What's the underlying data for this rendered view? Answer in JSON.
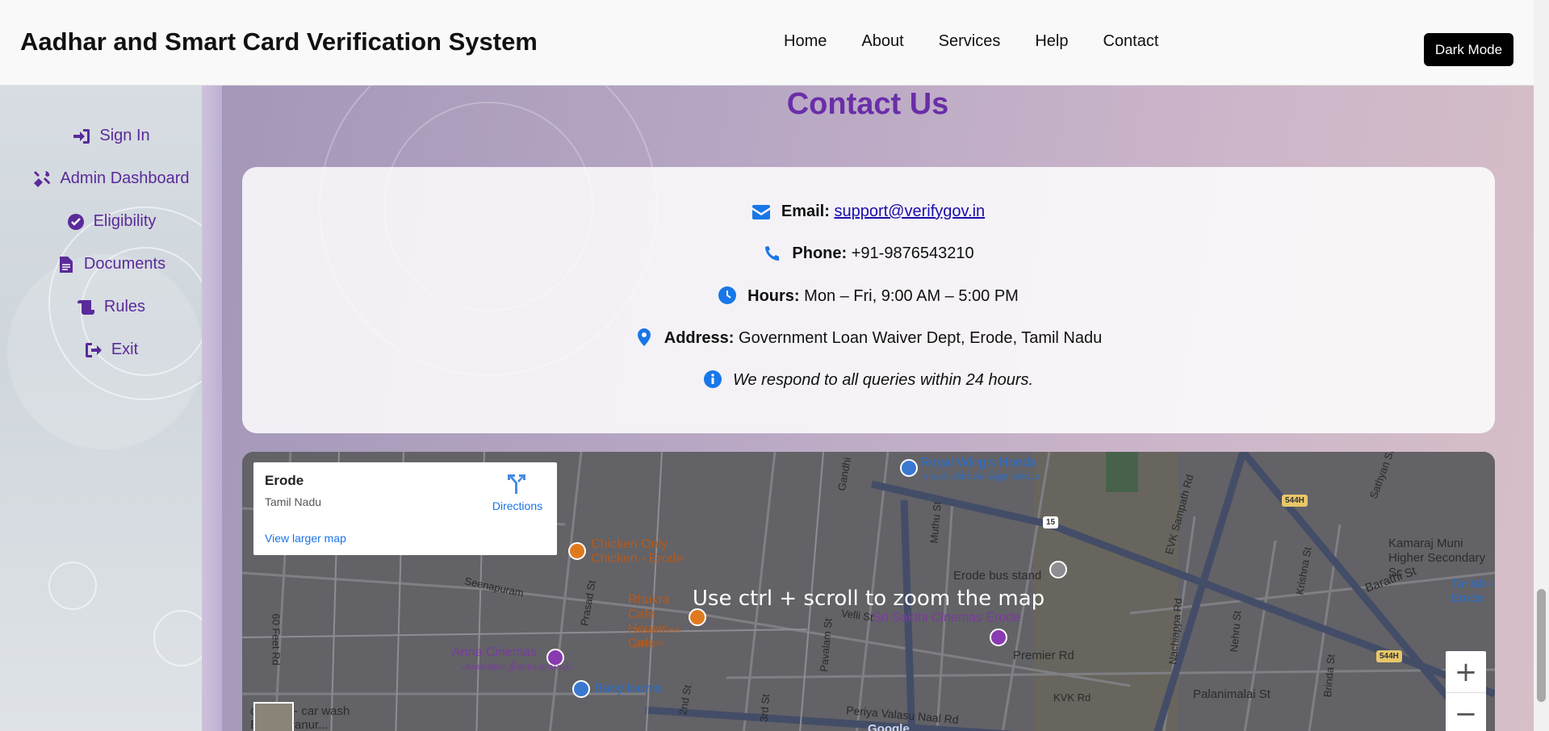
{
  "header": {
    "title": "Aadhar and Smart Card Verification System",
    "nav": [
      "Home",
      "About",
      "Services",
      "Help",
      "Contact"
    ],
    "dark_mode_label": "Dark Mode"
  },
  "sidebar": {
    "items": [
      {
        "label": "Sign In",
        "icon": "sign-in-icon"
      },
      {
        "label": "Admin Dashboard",
        "icon": "tools-icon"
      },
      {
        "label": "Eligibility",
        "icon": "check-circle-icon"
      },
      {
        "label": "Documents",
        "icon": "file-icon"
      },
      {
        "label": "Rules",
        "icon": "scroll-icon"
      },
      {
        "label": "Exit",
        "icon": "sign-out-icon"
      }
    ]
  },
  "contact": {
    "title": "Contact Us",
    "email_label": "Email:",
    "email_value": "support@verifygov.in",
    "phone_label": "Phone:",
    "phone_value": "+91-9876543210",
    "hours_label": "Hours:",
    "hours_value": "Mon – Fri, 9:00 AM – 5:00 PM",
    "address_label": "Address:",
    "address_value": "Government Loan Waiver Dept, Erode, Tamil Nadu",
    "note": "We respond to all queries within 24 hours."
  },
  "map": {
    "place_name": "Erode",
    "place_region": "Tamil Nadu",
    "directions_label": "Directions",
    "view_larger": "View larger map",
    "hint": "Use ctrl + scroll to zoom the map",
    "zoom_in": "+",
    "zoom_out": "−",
    "labels": {
      "royal_wings": "Royal Wing's Honda",
      "royal_wings_ta": "ராயல் விங்ஸ் ஹொண்டா",
      "chicken_only": "Chicken Only Chicken - Erode",
      "rhukra": "Rhukra Cafe House - Cafe",
      "rhukra_ta": "ருக்ரா கேக் ஹவுஸ்",
      "anna_cinemas": "Anna Cinemas",
      "anna_cinemas_ta": "அண்ணா திரையரங்கம்",
      "baby_looms": "Baby looms",
      "bus_stand": "Erode bus stand",
      "sri_sakthi": "Sri Sakthi Cinemas Erode",
      "premier_rd": "Premier Rd",
      "kvk_rd": "KVK Rd",
      "palanimalai": "Palanimalai St",
      "periya_valasu": "Periya Valasu Naal Rd",
      "seenapuram": "Seenapuram",
      "prasad_st": "Prasad St",
      "feet_rd": "60 Feet Rd",
      "car_wash": "car care- car wash",
      "kasiyanur": "E. Kasiyanur...",
      "evk": "EVK Sampath Rd",
      "nachiappa": "Nachiappa Rd",
      "nehru": "Nehru St",
      "krishna": "Krishna St",
      "barathi": "Barathi St",
      "brinda": "Brinda St",
      "kamaraj": "Kamaraj Muni Higher Secondary Sc",
      "tanish": "Tanish - Erode",
      "muthu": "Muthu St",
      "velli": "Velli St",
      "pavalam": "Pavalam St",
      "gandhi": "Gandhi",
      "second": "2nd St",
      "third": "3rd St",
      "sathyan": "Sathyan St",
      "shield_544h_a": "544H",
      "shield_544h_b": "544H",
      "shield_15": "15",
      "google": "Google"
    }
  }
}
